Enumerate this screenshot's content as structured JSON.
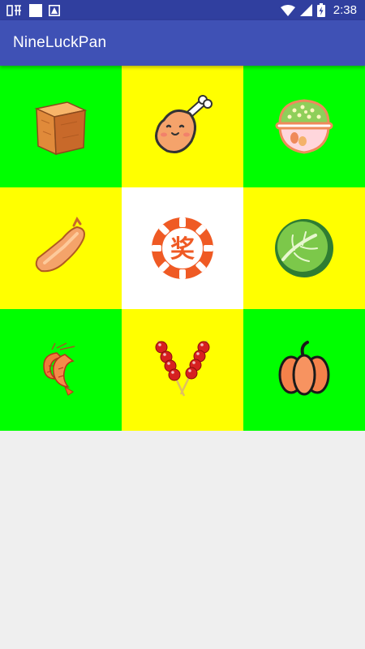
{
  "status_bar": {
    "time": "2:38",
    "left_icons": [
      "listen-app-icon",
      "notification-square-icon",
      "image-notification-icon"
    ],
    "right_icons": [
      "wifi-icon",
      "signal-icon",
      "battery-charging-icon"
    ]
  },
  "app_bar": {
    "title": "NineLuckPan",
    "color": "#3f51b5",
    "status_color": "#303f9f"
  },
  "grid": {
    "colors": {
      "green": "#00ff00",
      "yellow": "#ffff00",
      "center": "#ffffff"
    },
    "cells": [
      {
        "prize": "tofu-icon",
        "bg": "green"
      },
      {
        "prize": "drumstick-icon",
        "bg": "yellow"
      },
      {
        "prize": "rice-bowl-icon",
        "bg": "green"
      },
      {
        "prize": "sausage-icon",
        "bg": "yellow"
      },
      {
        "prize": "lottery-start-button",
        "bg": "white",
        "label": "奖"
      },
      {
        "prize": "cabbage-icon",
        "bg": "yellow"
      },
      {
        "prize": "shrimp-icon",
        "bg": "green"
      },
      {
        "prize": "candied-haws-icon",
        "bg": "yellow"
      },
      {
        "prize": "pumpkin-icon",
        "bg": "green"
      }
    ]
  }
}
